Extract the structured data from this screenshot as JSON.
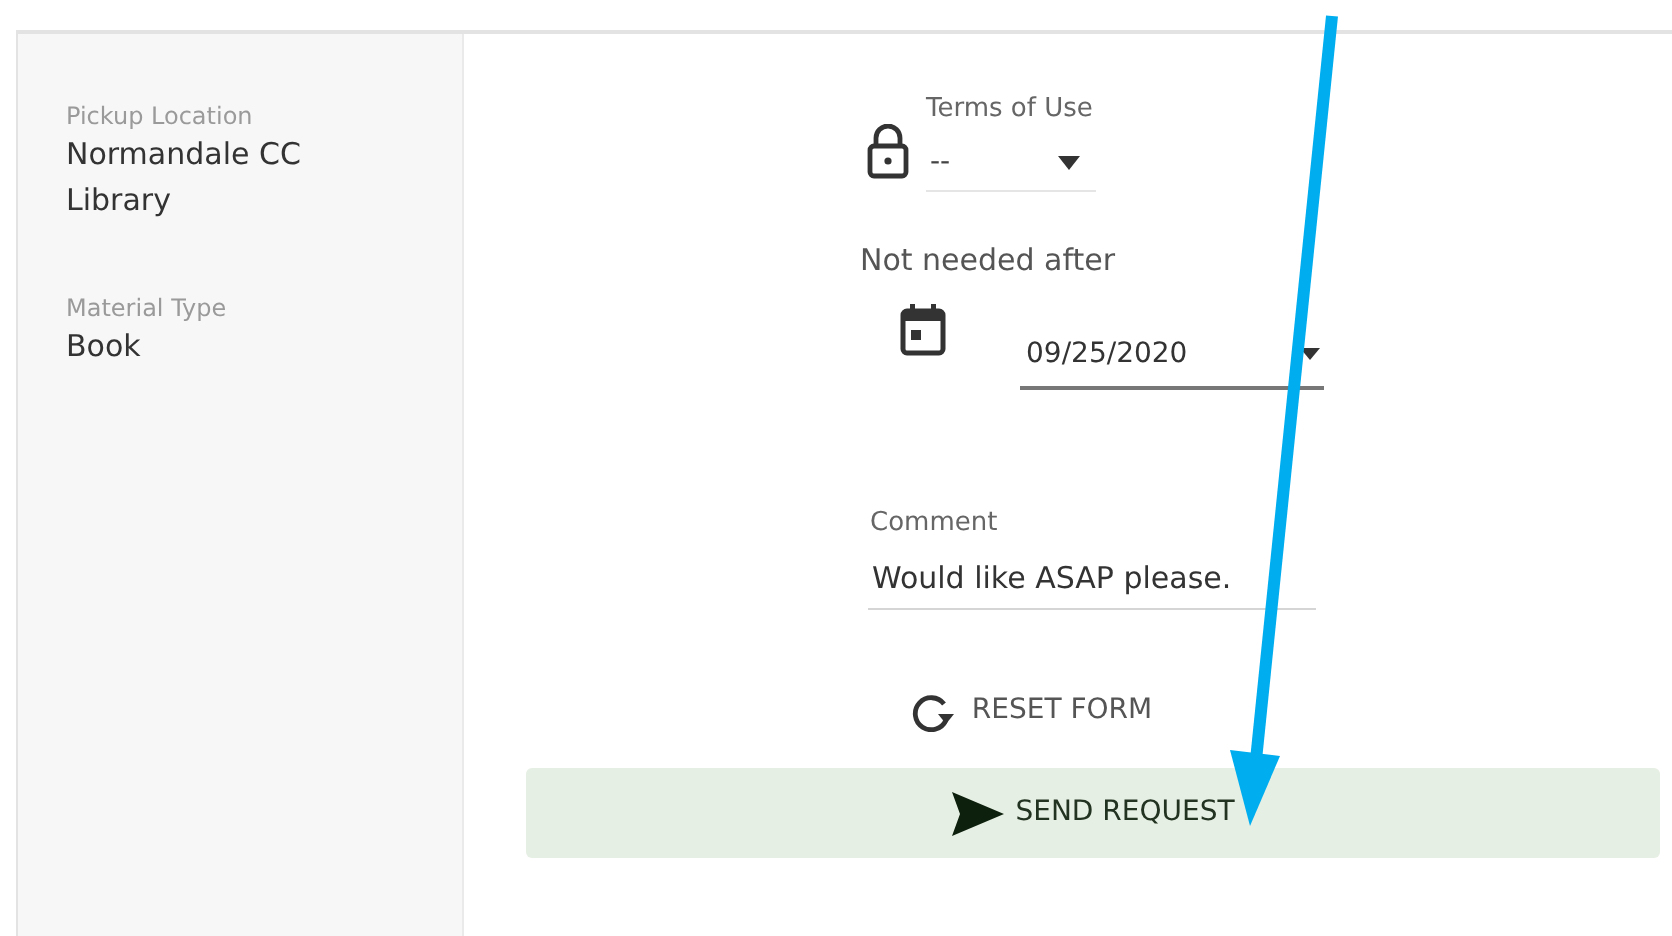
{
  "sidebar": {
    "fields": [
      {
        "label": "Pickup Location",
        "value": "Normandale CC Library"
      },
      {
        "label": "Material Type",
        "value": "Book"
      }
    ]
  },
  "form": {
    "terms_of_use": {
      "label": "Terms of Use",
      "value": "--"
    },
    "not_needed_after": {
      "label": "Not needed after",
      "value": "09/25/2020"
    },
    "comment": {
      "label": "Comment",
      "value": "Would like ASAP please."
    },
    "reset_button": "RESET FORM",
    "send_button": "SEND REQUEST"
  }
}
